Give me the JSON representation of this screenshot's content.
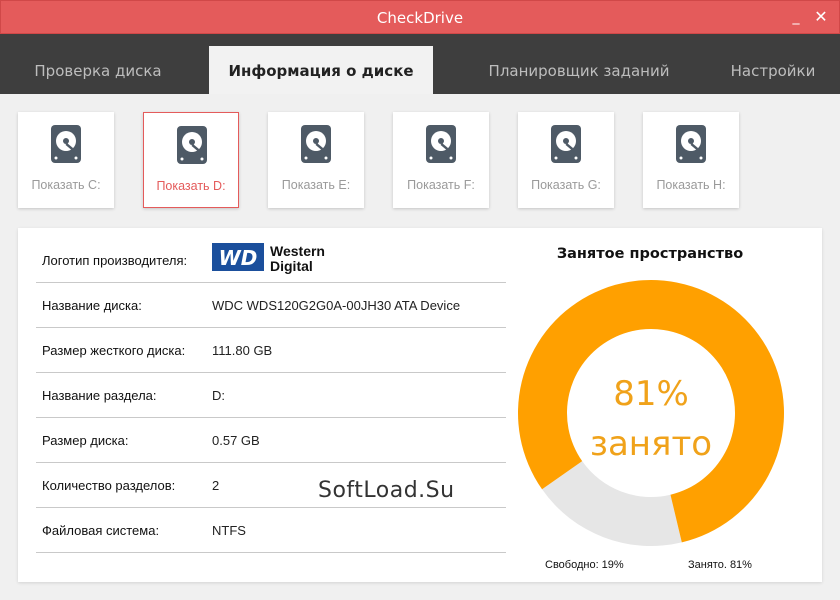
{
  "window": {
    "title": "CheckDrive",
    "minimize_glyph": "_",
    "close_glyph": "✕"
  },
  "tabs": [
    {
      "label": "Проверка диска",
      "active": false
    },
    {
      "label": "Информация о диске",
      "active": true
    },
    {
      "label": "Планировщик заданий",
      "active": false
    },
    {
      "label": "Настройки",
      "active": false
    }
  ],
  "drives": [
    {
      "label": "Показать C:",
      "icon": "hard-drive-icon",
      "selected": false
    },
    {
      "label": "Показать D:",
      "icon": "hard-drive-icon",
      "selected": true
    },
    {
      "label": "Показать E:",
      "icon": "hard-drive-icon",
      "selected": false
    },
    {
      "label": "Показать F:",
      "icon": "hard-drive-icon",
      "selected": false
    },
    {
      "label": "Показать G:",
      "icon": "hard-drive-icon",
      "selected": false
    },
    {
      "label": "Показать H:",
      "icon": "hard-drive-icon",
      "selected": false
    }
  ],
  "info": {
    "rows": [
      {
        "key": "Логотип производителя:",
        "value": ""
      },
      {
        "key": "Название диска:",
        "value": "WDC WDS120G2G0A-00JH30 ATA Device"
      },
      {
        "key": "Размер жесткого диска:",
        "value": "111.80 GB"
      },
      {
        "key": "Название раздела:",
        "value": "D:"
      },
      {
        "key": "Размер диска:",
        "value": "0.57 GB"
      },
      {
        "key": "Количество разделов:",
        "value": "2"
      },
      {
        "key": "Файловая система:",
        "value": "NTFS"
      }
    ],
    "logo": {
      "badge": "WD",
      "line1": "Western",
      "line2": "Digital"
    }
  },
  "watermark": "SoftLoad.Su",
  "usage": {
    "title": "Занятое пространство",
    "percent_text": "81%",
    "status_text": "занято",
    "free_label": "Свободно: 19%",
    "used_label": "Занято. 81%"
  },
  "chart_data": {
    "type": "pie",
    "title": "Занятое пространство",
    "categories": [
      "Свободно",
      "Занято"
    ],
    "values": [
      19,
      81
    ],
    "colors": [
      "#e6e6e6",
      "#ffa000"
    ]
  },
  "colors": {
    "accent": "#e45b5b",
    "tabbar": "#3e3e3e",
    "used": "#ffa000",
    "free": "#e6e6e6",
    "drive_icon": "#4e5a66"
  }
}
